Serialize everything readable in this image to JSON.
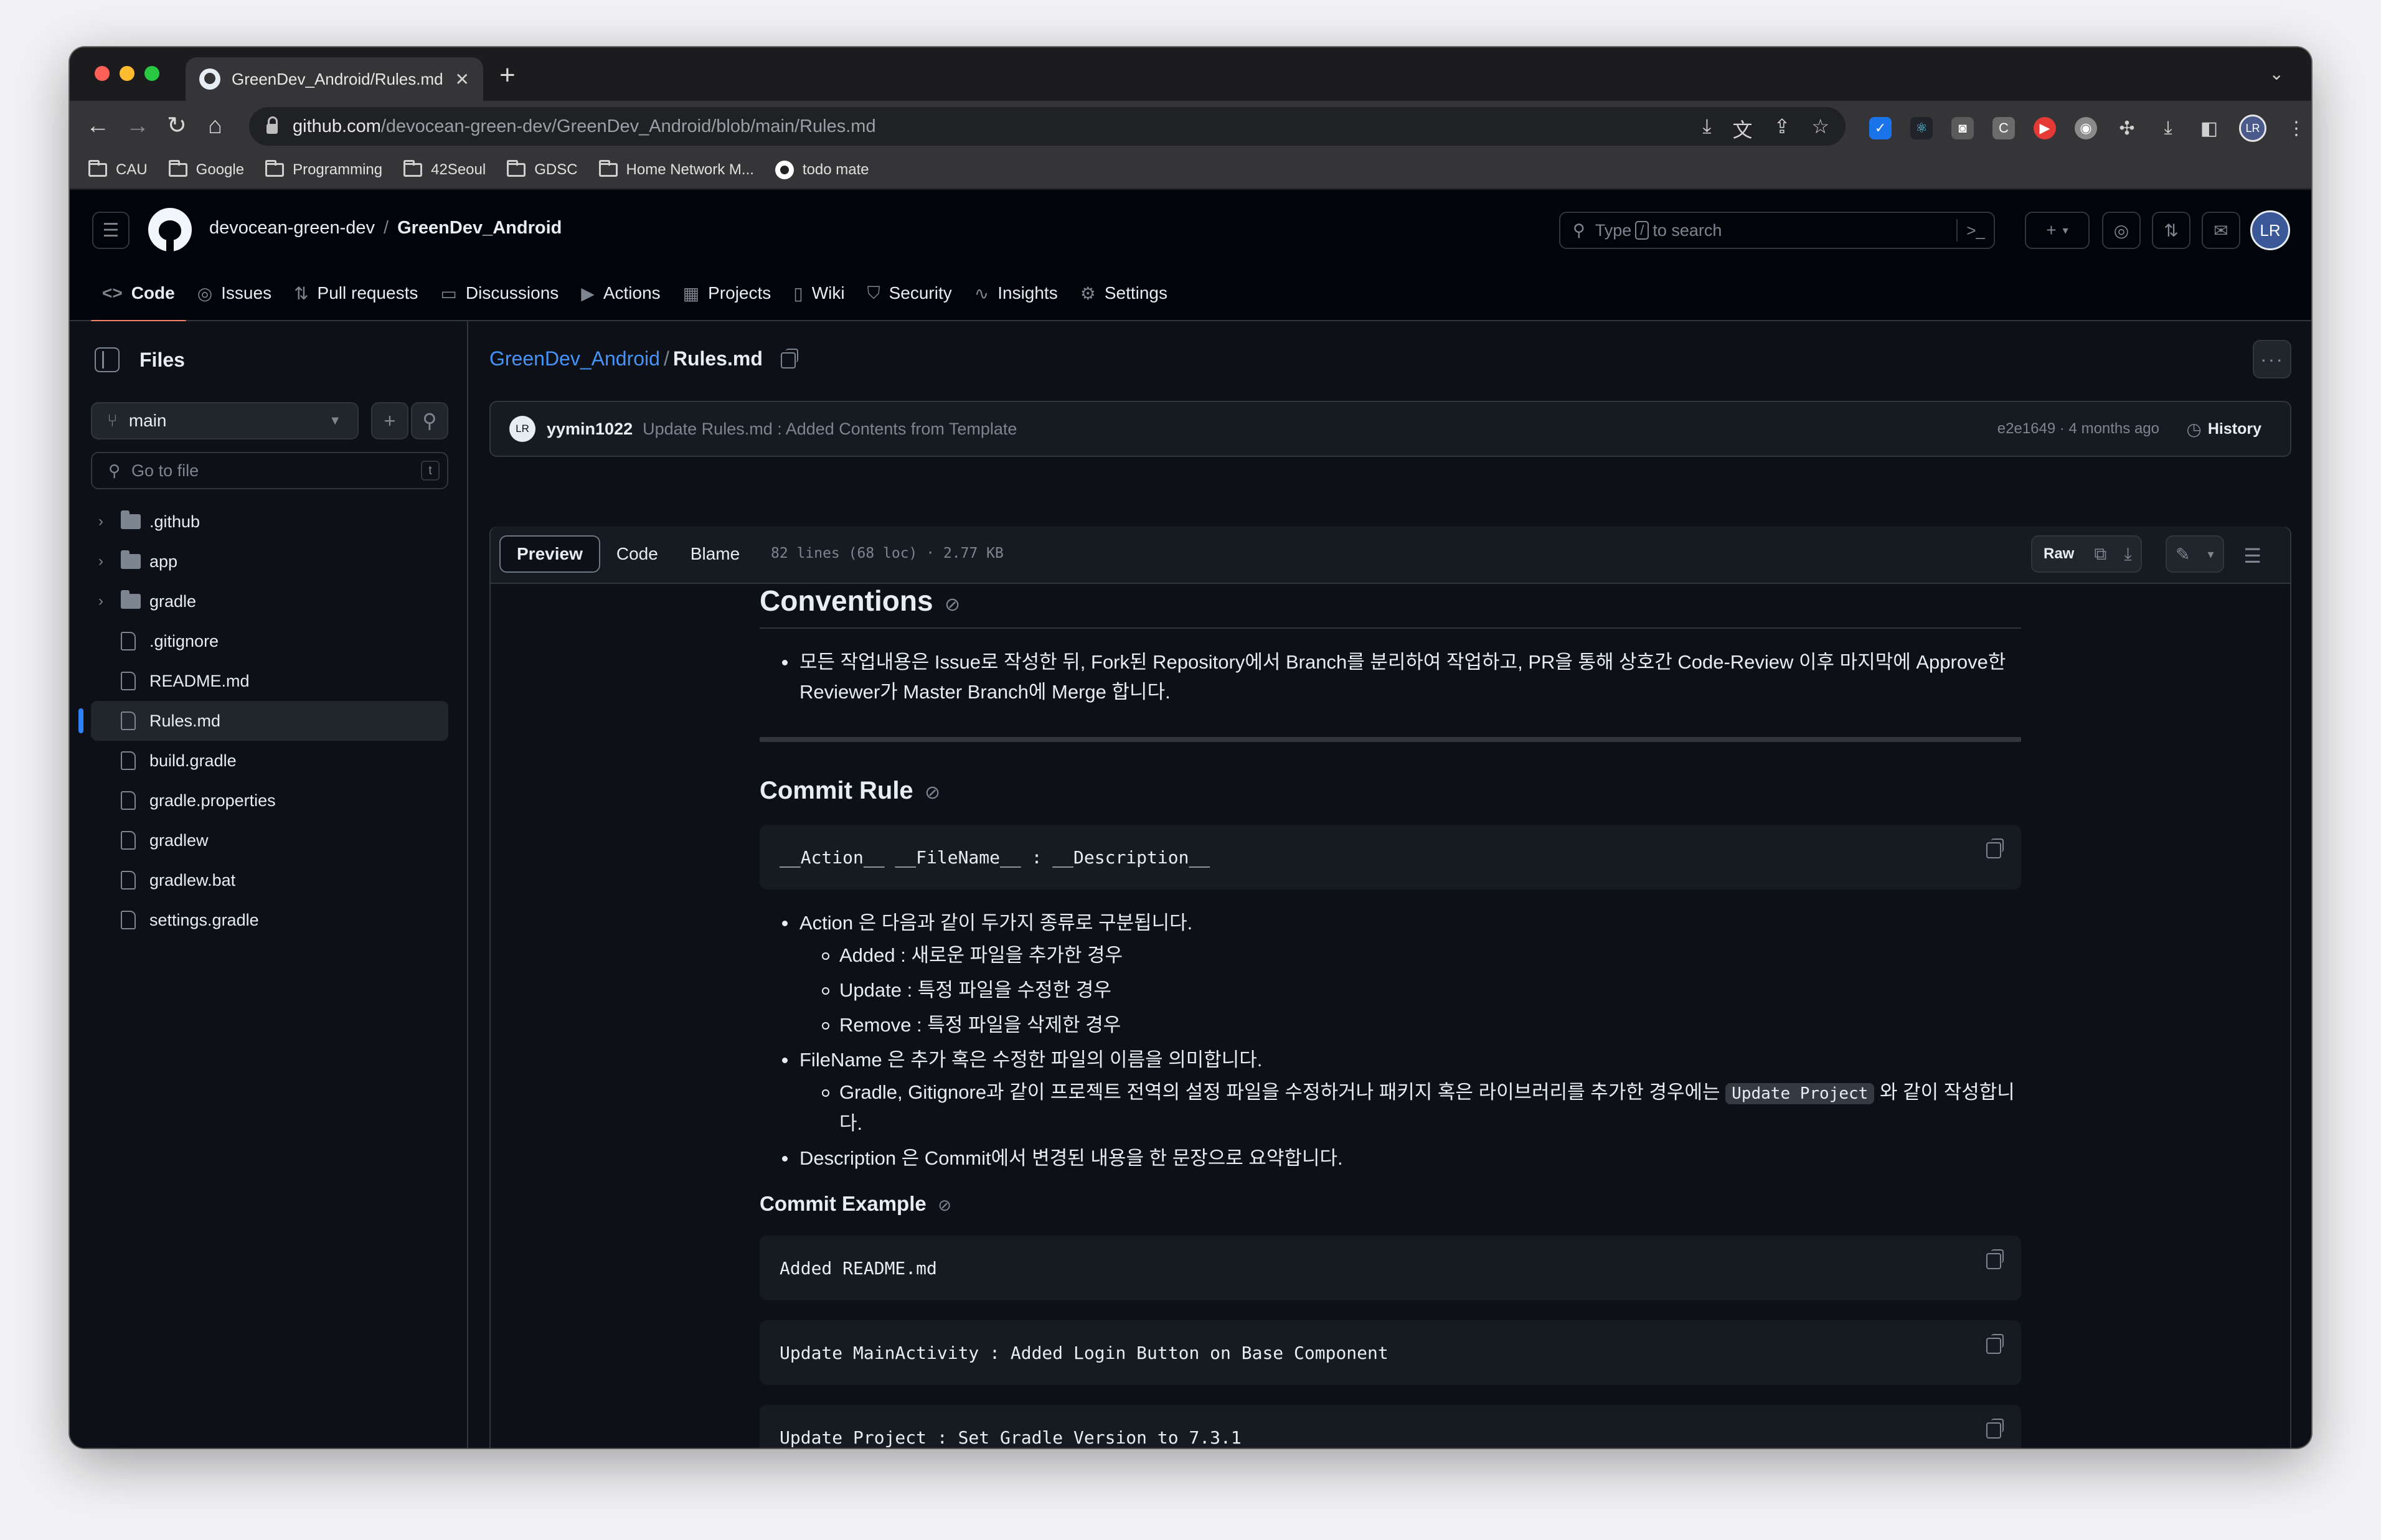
{
  "browser": {
    "tab_title": "GreenDev_Android/Rules.md a",
    "url_host": "github.com",
    "url_path": "/devocean-green-dev/GreenDev_Android/blob/main/Rules.md",
    "bookmarks": [
      "CAU",
      "Google",
      "Programming",
      "42Seoul",
      "GDSC",
      "Home Network M...",
      "todo mate"
    ],
    "profile_initials": "LR"
  },
  "header": {
    "owner": "devocean-green-dev",
    "separator": "/",
    "repo": "GreenDev_Android",
    "search_prefix": "Type",
    "search_key": "/",
    "search_suffix": "to search",
    "avatar_initials": "LR"
  },
  "repo_nav": [
    {
      "label": "Code",
      "icon": "<>",
      "selected": true
    },
    {
      "label": "Issues",
      "icon": "◎"
    },
    {
      "label": "Pull requests",
      "icon": "⇅"
    },
    {
      "label": "Discussions",
      "icon": "▭"
    },
    {
      "label": "Actions",
      "icon": "▶"
    },
    {
      "label": "Projects",
      "icon": "▦"
    },
    {
      "label": "Wiki",
      "icon": "▯"
    },
    {
      "label": "Security",
      "icon": "⛉"
    },
    {
      "label": "Insights",
      "icon": "∿"
    },
    {
      "label": "Settings",
      "icon": "⚙"
    }
  ],
  "sidebar": {
    "title": "Files",
    "branch": "main",
    "goto_placeholder": "Go to file",
    "goto_key": "t",
    "tree": [
      {
        "name": ".github",
        "type": "dir"
      },
      {
        "name": "app",
        "type": "dir"
      },
      {
        "name": "gradle",
        "type": "dir"
      },
      {
        "name": ".gitignore",
        "type": "file"
      },
      {
        "name": "README.md",
        "type": "file"
      },
      {
        "name": "Rules.md",
        "type": "file",
        "active": true
      },
      {
        "name": "build.gradle",
        "type": "file"
      },
      {
        "name": "gradle.properties",
        "type": "file"
      },
      {
        "name": "gradlew",
        "type": "file"
      },
      {
        "name": "gradlew.bat",
        "type": "file"
      },
      {
        "name": "settings.gradle",
        "type": "file"
      }
    ]
  },
  "main": {
    "breadcrumb_root": "GreenDev_Android",
    "breadcrumb_sep": "/",
    "breadcrumb_file": "Rules.md",
    "commit": {
      "avatar": "LR",
      "author": "yymin1022",
      "message": "Update Rules.md : Added Contents from Template",
      "meta": "e2e1649 · 4 months ago",
      "history_label": "History"
    },
    "file_toolbar": {
      "tabs": [
        "Preview",
        "Code",
        "Blame"
      ],
      "info": "82 lines (68 loc) · 2.77 KB",
      "raw_label": "Raw"
    },
    "content": {
      "h_conventions": "Conventions",
      "conventions_item": "모든 작업내용은 Issue로 작성한 뒤, Fork된 Repository에서 Branch를 분리하여 작업하고, PR을 통해 상호간 Code-Review 이후 마지막에 Approve한 Reviewer가 Master Branch에 Merge 합니다.",
      "h_commit_rule": "Commit Rule",
      "commit_format": "__Action__ __FileName__ : __Description__",
      "action_item": "Action 은 다음과 같이 두가지 종류로 구분됩니다.",
      "action_sub": [
        "Added : 새로운 파일을 추가한 경우",
        "Update : 특정 파일을 수정한 경우",
        "Remove : 특정 파일을 삭제한 경우"
      ],
      "filename_item": "FileName 은 추가 혹은 수정한 파일의 이름을 의미합니다.",
      "filename_sub_before": "Gradle, Gitignore과 같이 프로젝트 전역의 설정 파일을 수정하거나 패키지 혹은 라이브러리를 추가한 경우에는 ",
      "filename_sub_code": "Update Project",
      "filename_sub_after": " 와 같이 작성합니다.",
      "description_item": "Description 은 Commit에서 변경된 내용을 한 문장으로 요약합니다.",
      "h_commit_example": "Commit Example",
      "examples": [
        "Added README.md",
        "Update MainActivity : Added Login Button on Base Component",
        "Update Project : Set Gradle Version to 7.3.1"
      ]
    }
  }
}
